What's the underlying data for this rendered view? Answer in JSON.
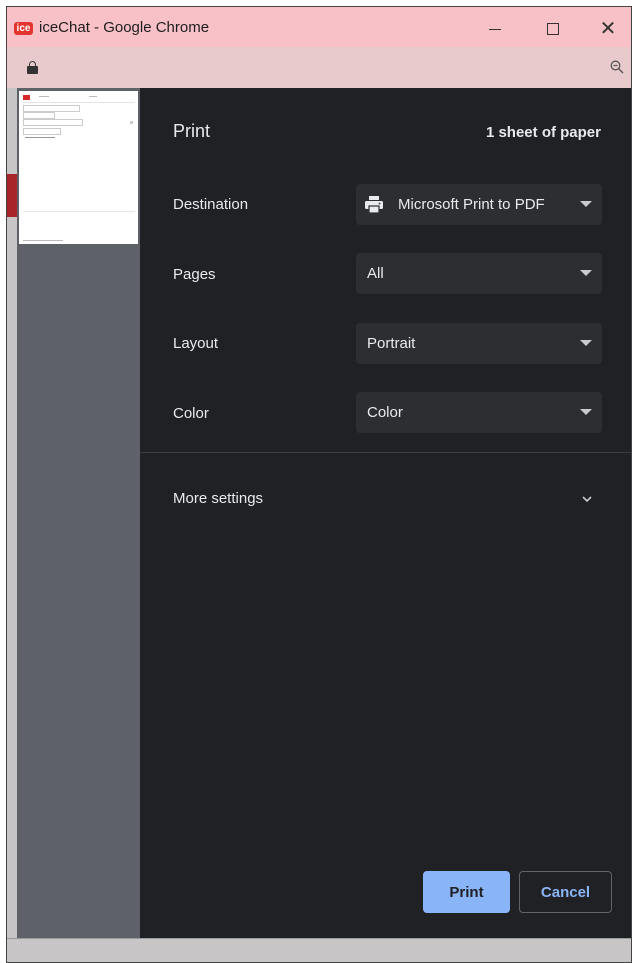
{
  "window": {
    "app_icon_text": "ice",
    "title": "iceChat - Google Chrome",
    "minimize_icon": "minimize-icon",
    "maximize_icon": "maximize-icon",
    "close_icon": "close-icon"
  },
  "addressbar": {
    "lock_icon": "lock-icon",
    "zoom_icon": "zoom-out-icon"
  },
  "print_dialog": {
    "title": "Print",
    "sheet_count": "1 sheet of paper",
    "destination": {
      "label": "Destination",
      "value": "Microsoft Print to PDF",
      "icon": "printer-icon"
    },
    "pages": {
      "label": "Pages",
      "value": "All"
    },
    "layout": {
      "label": "Layout",
      "value": "Portrait"
    },
    "color": {
      "label": "Color",
      "value": "Color"
    },
    "more_settings": {
      "label": "More settings",
      "icon": "chevron-down-icon"
    },
    "buttons": {
      "print": "Print",
      "cancel": "Cancel"
    }
  },
  "colors": {
    "title_bar": "#f7c1c7",
    "dialog_bg": "#202124",
    "select_bg": "#2d2e31",
    "accent": "#8ab4f8"
  }
}
